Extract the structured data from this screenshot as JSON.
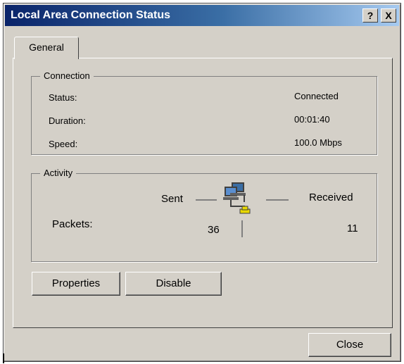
{
  "window": {
    "title": "Local Area Connection Status"
  },
  "titlebar_buttons": {
    "help": "?",
    "close": "X"
  },
  "tabs": [
    {
      "label": "General"
    }
  ],
  "connection": {
    "title": "Connection",
    "status_label": "Status:",
    "status_value": "Connected",
    "duration_label": "Duration:",
    "duration_value": "00:01:40",
    "speed_label": "Speed:",
    "speed_value": "100.0 Mbps"
  },
  "activity": {
    "title": "Activity",
    "sent_label": "Sent",
    "received_label": "Received",
    "packets_label": "Packets:",
    "packets_sent": "36",
    "packets_received": "11",
    "icon": "network-computers-icon"
  },
  "buttons": {
    "properties": "Properties",
    "disable": "Disable",
    "close": "Close"
  }
}
